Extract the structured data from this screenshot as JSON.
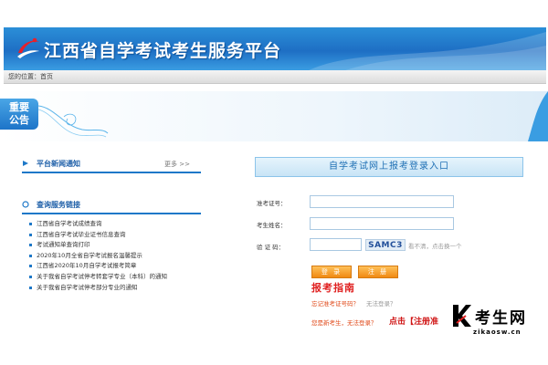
{
  "header": {
    "title": "江西省自学考试考生服务平台",
    "logo_icon": "swoosh-logo-icon",
    "brand_color": "#1e6fc4"
  },
  "breadcrumb": {
    "prefix": "您的位置：",
    "current": "首页"
  },
  "notice": {
    "tag": "重要\n公告"
  },
  "news_panel": {
    "title": "平台新闻通知",
    "more": "更多 >>"
  },
  "links_panel": {
    "title": "查询服务链接",
    "items": [
      "江西省自学考试成绩查询",
      "江西省自学考试毕业证书信息查询",
      "考试通知单查询打印",
      "2020年10月全省自学考试报名温馨提示",
      "江西省2020年10月自学考试报考简章",
      "关于我省自学考试停考转套学专业（本科）的通知",
      "关于我省自学考试停考部分专业的通知"
    ]
  },
  "login": {
    "heading": "自学考试网上报考登录入口",
    "admission_label": "准考证号：",
    "name_label": "考生姓名：",
    "captcha_label": "验 证 码：",
    "captcha_code": "SAMC3",
    "captcha_tip": "看不清，点击换一个",
    "login_button": "登 录",
    "register_button": "注 册",
    "guide": "报考指南",
    "forgot_text": "忘记准考证号码？",
    "forgot_sub": "无法登录？",
    "new_student_text": "您是新考生，无法登录？",
    "register_prompt": "点击【注册准"
  },
  "watermark": {
    "text": "考生网",
    "url": "zikaosw.cn"
  }
}
